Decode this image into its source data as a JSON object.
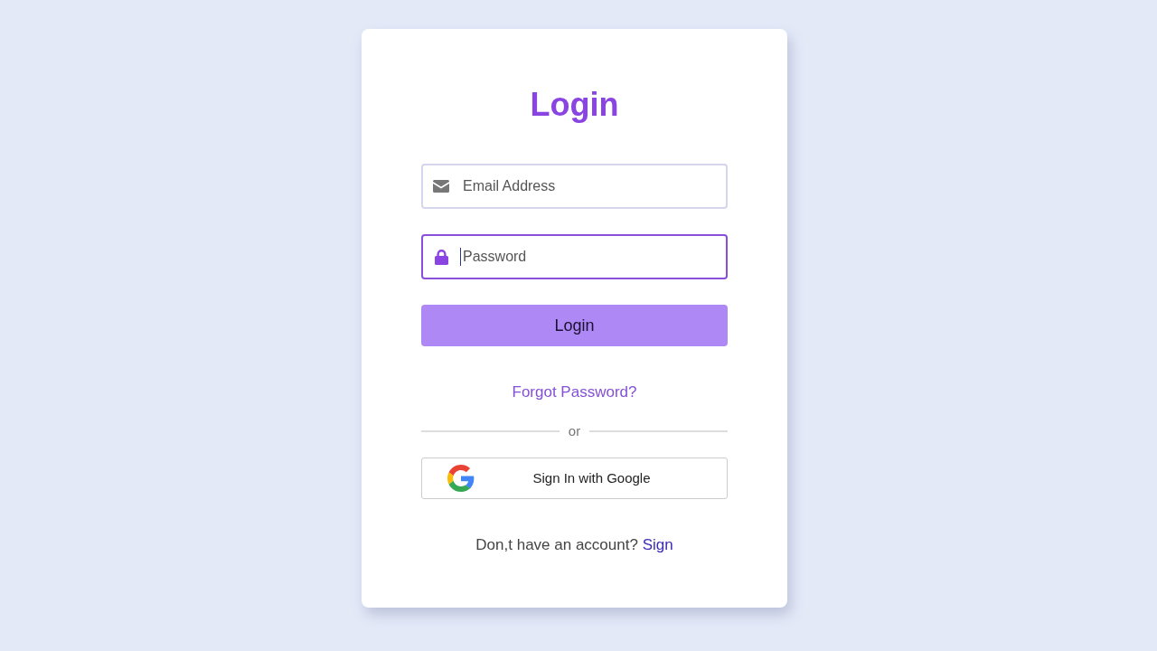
{
  "title": "Login",
  "fields": [
    {
      "kind": "email",
      "placeholder": "Email Address",
      "focused": false
    },
    {
      "kind": "password",
      "placeholder": "Password",
      "focused": true
    }
  ],
  "login_button": {
    "label": "Login"
  },
  "forgot_link": "Forgot Password?",
  "divider_text": "or",
  "social_button": {
    "label": "Sign In with Google"
  },
  "footer": {
    "text": "Don,t have an account?",
    "link": "Sign"
  }
}
